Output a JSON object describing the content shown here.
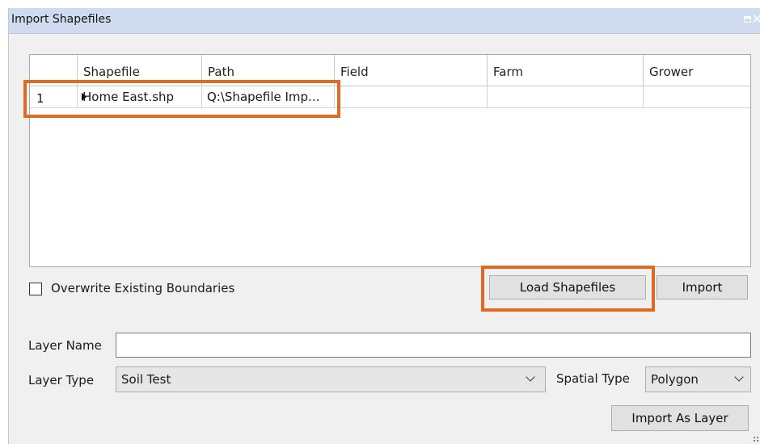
{
  "window": {
    "title": "Import Shapefiles",
    "restore_icon": "restore-icon",
    "close_icon": "close-icon",
    "close_glyph": "✕"
  },
  "grid": {
    "columns": [
      "",
      "Shapefile",
      "Path",
      "Field",
      "Farm",
      "Grower"
    ],
    "rows": [
      {
        "num": "1",
        "shapefile": "Home East.shp",
        "path": "Q:\\Shapefile Imp...",
        "field": "",
        "farm": "",
        "grower": ""
      }
    ],
    "row_indicator_icon": "triangle-right-icon"
  },
  "options": {
    "overwrite_label": "Overwrite Existing Boundaries",
    "overwrite_checked": false
  },
  "buttons": {
    "load": "Load Shapefiles",
    "import": "Import",
    "import_layer": "Import As Layer"
  },
  "layer": {
    "name_label": "Layer Name",
    "name_value": "",
    "type_label": "Layer Type",
    "type_value": "Soil Test",
    "spatial_label": "Spatial Type",
    "spatial_value": "Polygon"
  },
  "colors": {
    "highlight": "#e06a21",
    "titlebar": "#cfdcef",
    "background": "#f0f0f0"
  }
}
